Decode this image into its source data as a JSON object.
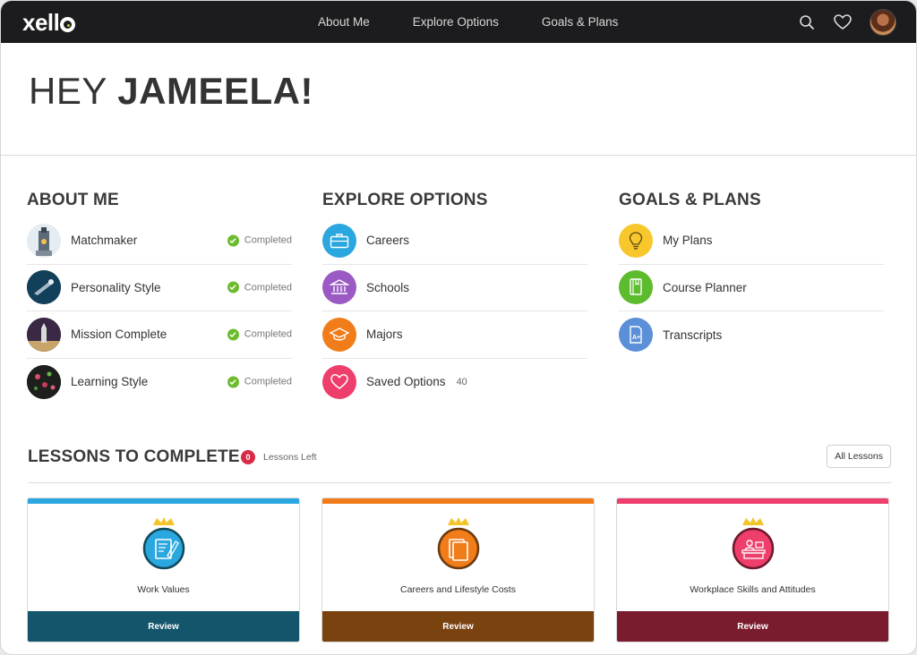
{
  "app": {
    "logo": "xell"
  },
  "nav": {
    "items": [
      "About Me",
      "Explore Options",
      "Goals & Plans"
    ]
  },
  "greeting": {
    "hey": "HEY",
    "name": "JAMEELA!"
  },
  "about_me": {
    "title": "ABOUT ME",
    "items": [
      {
        "label": "Matchmaker",
        "status": "Completed"
      },
      {
        "label": "Personality Style",
        "status": "Completed"
      },
      {
        "label": "Mission Complete",
        "status": "Completed"
      },
      {
        "label": "Learning Style",
        "status": "Completed"
      }
    ]
  },
  "explore": {
    "title": "EXPLORE OPTIONS",
    "items": [
      {
        "label": "Careers",
        "icon": "briefcase-icon",
        "color": "#2aa7df"
      },
      {
        "label": "Schools",
        "icon": "school-icon",
        "color": "#9b59c4"
      },
      {
        "label": "Majors",
        "icon": "graduation-cap-icon",
        "color": "#f07d1a"
      },
      {
        "label": "Saved Options",
        "count": "40",
        "icon": "heart-icon",
        "color": "#ee3e6b"
      }
    ]
  },
  "goals": {
    "title": "GOALS & PLANS",
    "items": [
      {
        "label": "My Plans",
        "icon": "lightbulb-icon",
        "color": "#f7c72b"
      },
      {
        "label": "Course Planner",
        "icon": "book-icon",
        "color": "#5dbb2e"
      },
      {
        "label": "Transcripts",
        "icon": "transcript-icon",
        "color": "#5b8fd8"
      }
    ]
  },
  "lessons": {
    "title": "LESSONS TO COMPLETE",
    "left_count": "0",
    "left_label": "Lessons Left",
    "all_button": "All Lessons",
    "cards": [
      {
        "title": "Work Values",
        "button": "Review",
        "accent": "#2aa7df",
        "footer": "#13566b"
      },
      {
        "title": "Careers and Lifestyle Costs",
        "button": "Review",
        "accent": "#f07d1a",
        "footer": "#7a420f"
      },
      {
        "title": "Workplace Skills and Attitudes",
        "button": "Review",
        "accent": "#ee3e6b",
        "footer": "#7a1b2e"
      }
    ]
  }
}
